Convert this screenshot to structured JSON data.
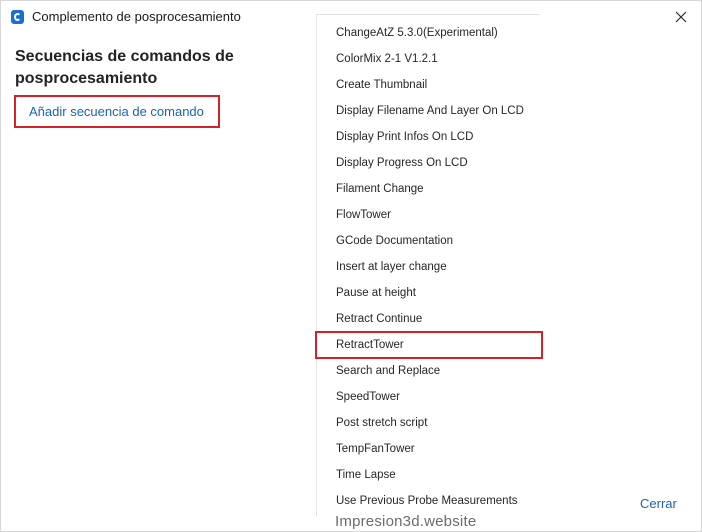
{
  "window": {
    "title": "Complemento de posprocesamiento",
    "close_icon": "close-icon"
  },
  "panel": {
    "heading": "Secuencias de comandos de posprocesamiento",
    "add_script_label": "Añadir secuencia de comando"
  },
  "menu": {
    "items": [
      "ChangeAtZ 5.3.0(Experimental)",
      "ColorMix 2-1 V1.2.1",
      "Create Thumbnail",
      "Display Filename And Layer On LCD",
      "Display Print Infos On LCD",
      "Display Progress On LCD",
      "Filament Change",
      "FlowTower",
      "GCode Documentation",
      "Insert at layer change",
      "Pause at height",
      "Retract Continue",
      "RetractTower",
      "Search and Replace",
      "SpeedTower",
      "Post stretch script",
      "TempFanTower",
      "Time Lapse",
      "Use Previous Probe Measurements"
    ],
    "highlighted_item": "RetractTower"
  },
  "footer": {
    "close_label": "Cerrar"
  },
  "watermark": "Impresion3d.website",
  "colors": {
    "accent": "#1a63b8",
    "highlight_border": "#d6202a"
  }
}
